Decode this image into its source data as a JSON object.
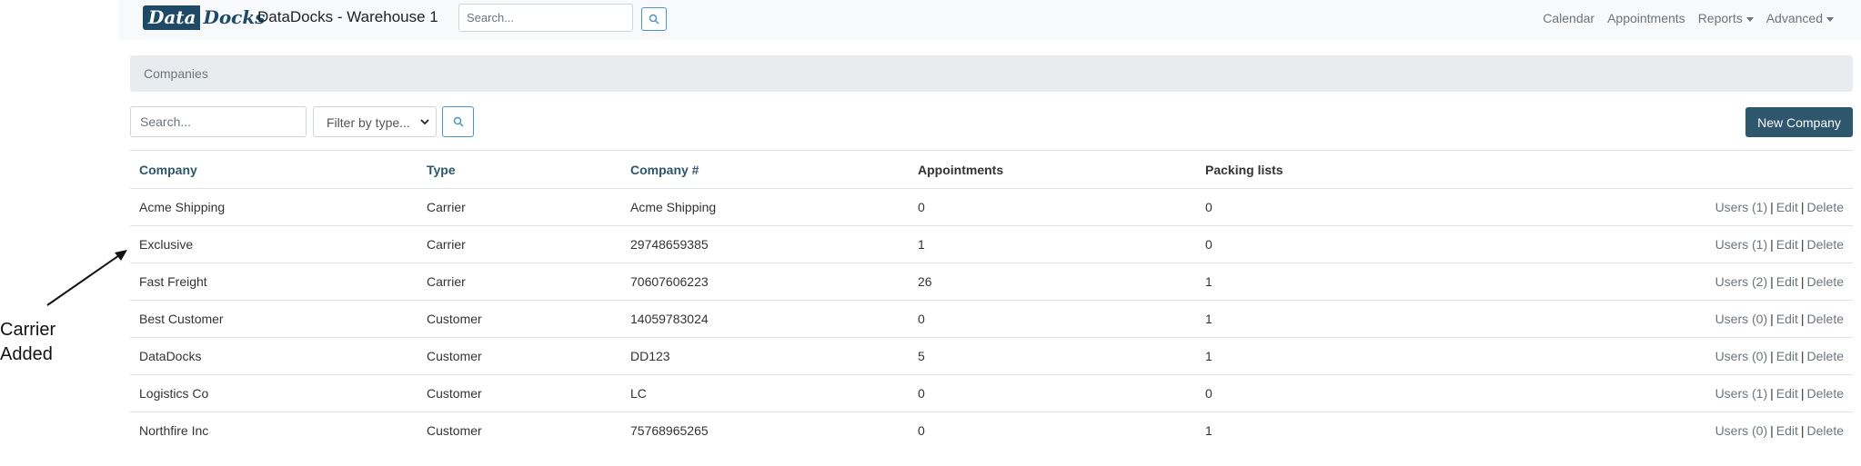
{
  "navbar": {
    "logo": {
      "part1": "Data",
      "part2": "Docks"
    },
    "title": "DataDocks - Warehouse 1",
    "search_placeholder": "Search...",
    "links": {
      "calendar": "Calendar",
      "appointments": "Appointments",
      "reports": "Reports",
      "advanced": "Advanced"
    }
  },
  "breadcrumb": {
    "current": "Companies"
  },
  "filters": {
    "search_placeholder": "Search...",
    "type_selected": "Filter by type..."
  },
  "new_company_label": "New Company",
  "table": {
    "headers": {
      "company": "Company",
      "type": "Type",
      "company_number": "Company #",
      "appointments": "Appointments",
      "packing_lists": "Packing lists"
    },
    "rows": [
      {
        "company": "Acme Shipping",
        "type": "Carrier",
        "number": "Acme Shipping",
        "appointments": "0",
        "packing": "0",
        "users": "Users (1)"
      },
      {
        "company": "Exclusive",
        "type": "Carrier",
        "number": "29748659385",
        "appointments": "1",
        "packing": "0",
        "users": "Users (1)"
      },
      {
        "company": "Fast Freight",
        "type": "Carrier",
        "number": "70607606223",
        "appointments": "26",
        "packing": "1",
        "users": "Users (2)"
      },
      {
        "company": "Best Customer",
        "type": "Customer",
        "number": "14059783024",
        "appointments": "0",
        "packing": "1",
        "users": "Users (0)"
      },
      {
        "company": "DataDocks",
        "type": "Customer",
        "number": "DD123",
        "appointments": "5",
        "packing": "1",
        "users": "Users (0)"
      },
      {
        "company": "Logistics Co",
        "type": "Customer",
        "number": "LC",
        "appointments": "0",
        "packing": "0",
        "users": "Users (1)"
      },
      {
        "company": "Northfire Inc",
        "type": "Customer",
        "number": "75768965265",
        "appointments": "0",
        "packing": "1",
        "users": "Users (0)"
      }
    ],
    "action_labels": {
      "separator": "|",
      "edit": "Edit",
      "delete": "Delete"
    }
  },
  "annotation": {
    "line1": "Carrier",
    "line2": "Added"
  },
  "colors": {
    "brand": "#1e4a68",
    "button": "#2e566c",
    "link_muted": "#6c757d",
    "breadcrumb_bg": "#e9ecef",
    "navbar_bg": "#f8f9fa"
  },
  "icons": {
    "search_button": "search-icon",
    "annotation": "arrow-icon"
  }
}
